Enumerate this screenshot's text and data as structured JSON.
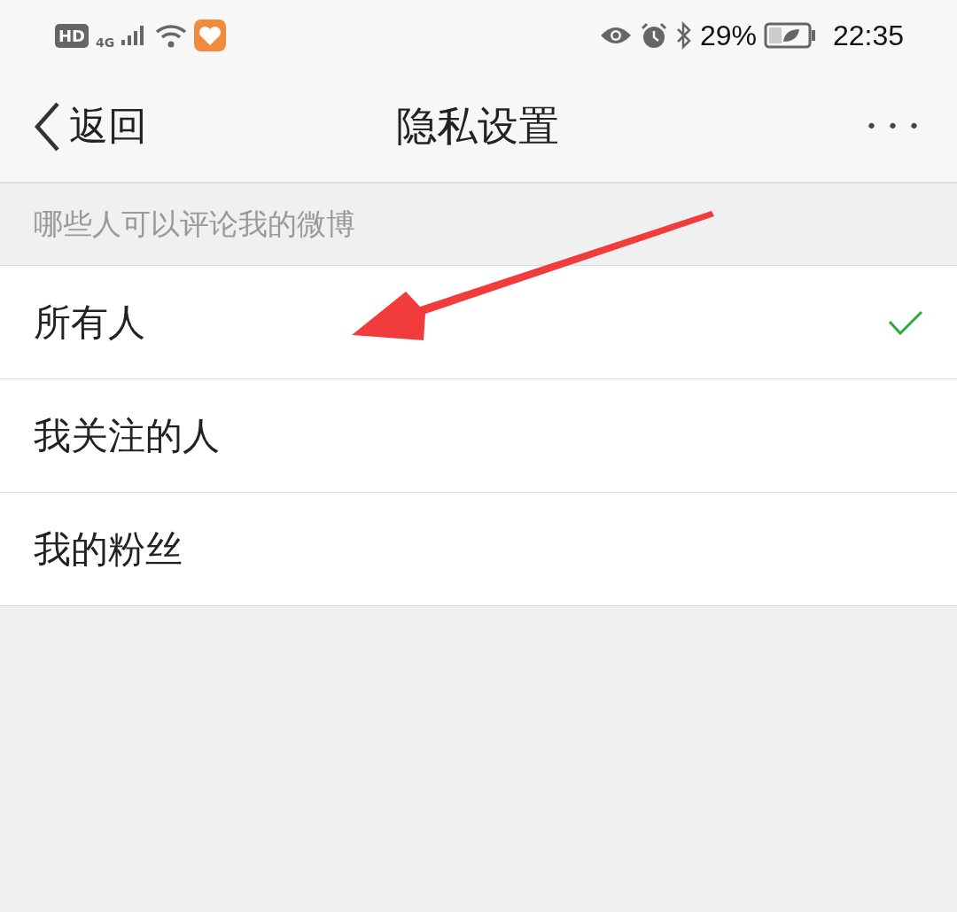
{
  "status_bar": {
    "hd": "HD",
    "network": "4G",
    "battery": "29%",
    "time": "22:35"
  },
  "nav_bar": {
    "back": "返回",
    "title": "隐私设置",
    "more": "• • •"
  },
  "section": {
    "title": "哪些人可以评论我的微博",
    "options": [
      {
        "label": "所有人",
        "selected": true
      },
      {
        "label": "我关注的人",
        "selected": false
      },
      {
        "label": "我的粉丝",
        "selected": false
      }
    ]
  },
  "annotation": {
    "kind": "arrow"
  }
}
